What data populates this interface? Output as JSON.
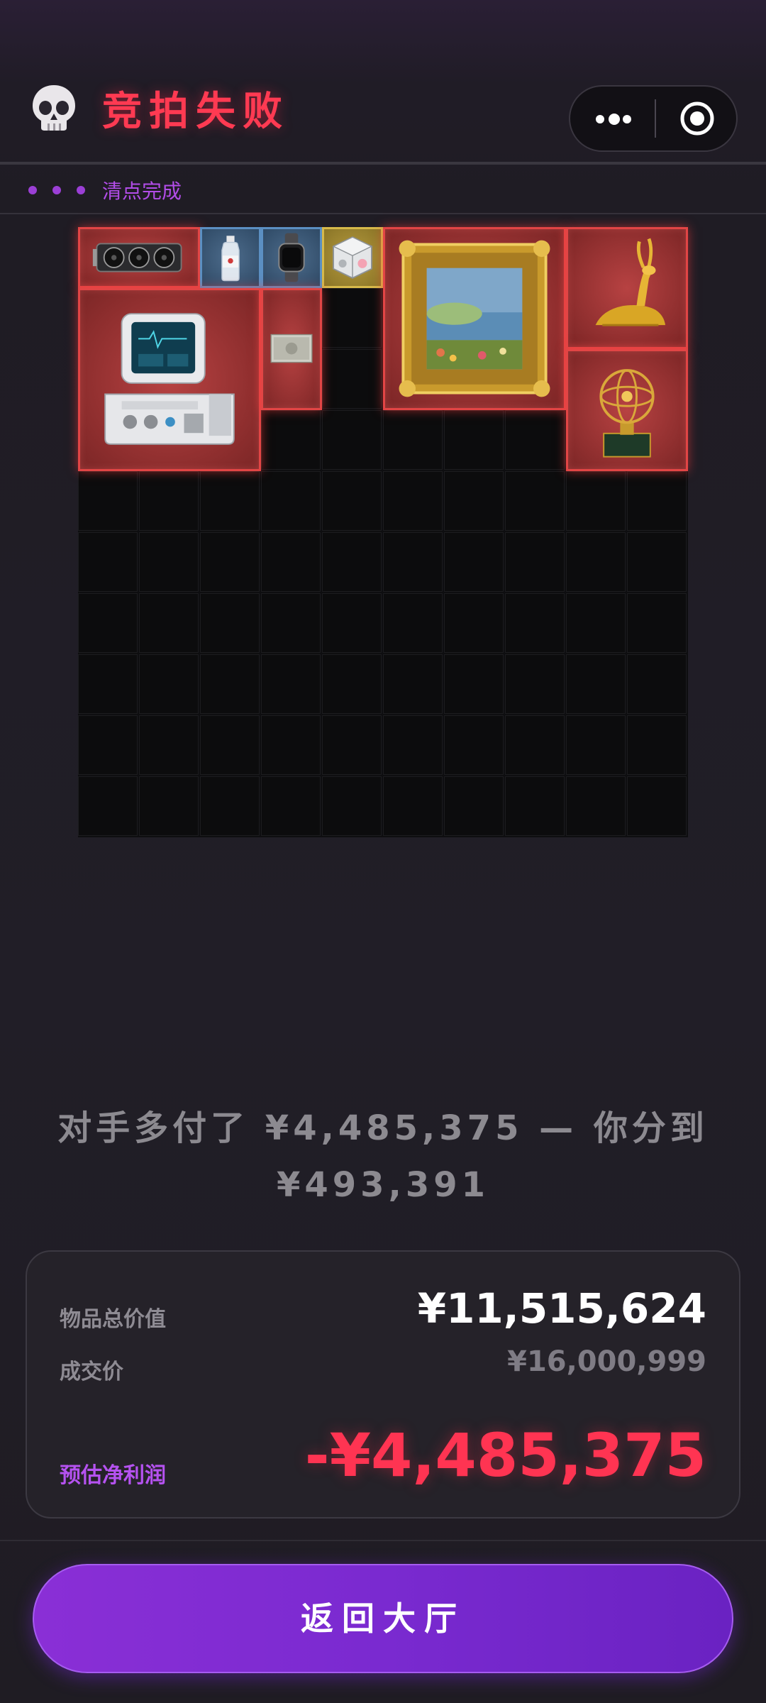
{
  "header": {
    "title": "竞拍失败",
    "skull_icon": "skull-icon",
    "more_icon": "more-dots-icon",
    "close_icon": "target-close-icon",
    "title_color": "#ff3a52"
  },
  "status": {
    "label": "清点完成"
  },
  "warehouse": {
    "items": [
      {
        "name": "graphics-card",
        "rarity": "red"
      },
      {
        "name": "water-bottle",
        "rarity": "blue"
      },
      {
        "name": "smartwatch",
        "rarity": "blue"
      },
      {
        "name": "companion-cube",
        "rarity": "gold"
      },
      {
        "name": "framed-painting",
        "rarity": "red"
      },
      {
        "name": "golden-deer-statue",
        "rarity": "red"
      },
      {
        "name": "medical-ventilator",
        "rarity": "red"
      },
      {
        "name": "cash-bundle",
        "rarity": "red"
      },
      {
        "name": "armillary-sphere",
        "rarity": "red"
      }
    ]
  },
  "message": {
    "line1": "对手多付了 ¥4,485,375 — 你分到",
    "line2": "¥493,391"
  },
  "summary": {
    "total_value_label": "物品总价值",
    "total_value": "¥11,515,624",
    "deal_price_label": "成交价",
    "deal_price": "¥16,000,999",
    "net_profit_label": "预估净利润",
    "net_profit": "-¥4,485,375",
    "net_profit_color": "#ff3452"
  },
  "actions": {
    "back_label": "返回大厅",
    "button_color": "#8a2fd6"
  }
}
